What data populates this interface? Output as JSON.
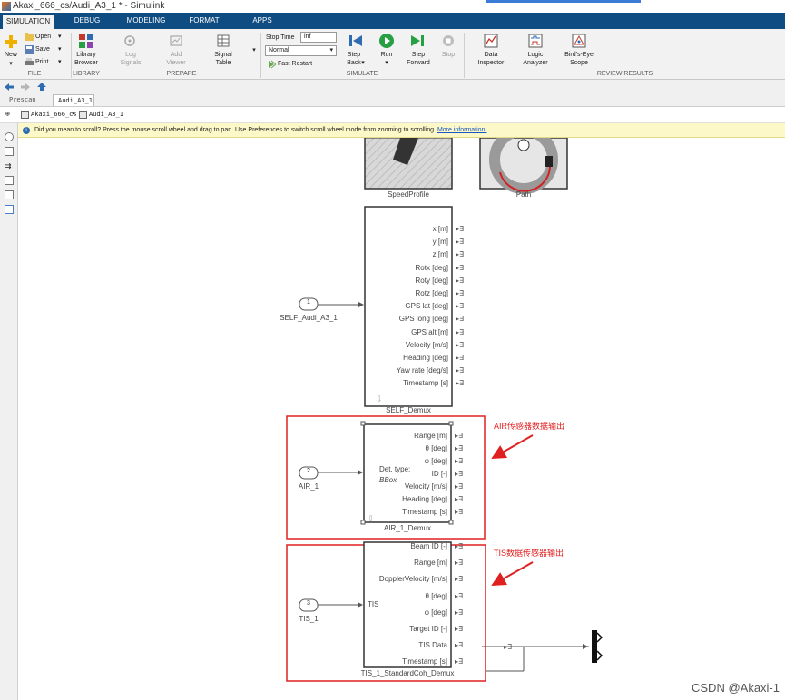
{
  "window": {
    "title": "Akaxi_666_cs/Audi_A3_1 * - Simulink"
  },
  "tabs": [
    "SIMULATION",
    "DEBUG",
    "MODELING",
    "FORMAT",
    "APPS"
  ],
  "ribbon": {
    "file": {
      "new_label": "New",
      "open_label": "Open",
      "save_label": "Save",
      "print_label": "Print",
      "group_label": "FILE"
    },
    "library": {
      "browser_label_1": "Library",
      "browser_label_2": "Browser",
      "group_label": "LIBRARY"
    },
    "prepare": {
      "log_signals_1": "Log",
      "log_signals_2": "Signals",
      "add_viewer_1": "Add",
      "add_viewer_2": "Viewer",
      "signal_table_1": "Signal",
      "signal_table_2": "Table",
      "group_label": "PREPARE"
    },
    "simulate": {
      "stop_time_label": "Stop Time",
      "stop_time_value": "inf",
      "mode_value": "Normal",
      "fast_restart_label": "Fast Restart",
      "step_back_1": "Step",
      "step_back_2": "Back",
      "run_label": "Run",
      "step_forward_1": "Step",
      "step_forward_2": "Forward",
      "stop_label": "Stop",
      "group_label": "SIMULATE"
    },
    "review": {
      "data_inspector_1": "Data",
      "data_inspector_2": "Inspector",
      "logic_analyzer_1": "Logic",
      "logic_analyzer_2": "Analyzer",
      "birds_eye_1": "Bird's-Eye",
      "birds_eye_2": "Scope",
      "group_label": "REVIEW RESULTS"
    }
  },
  "nav": {
    "prescan_label": "Prescan",
    "doc_tab": "Audi_A3_1",
    "crumb_root": "Akaxi_666_cs",
    "crumb_child": "Audi_A3_1"
  },
  "info": {
    "message": "Did you mean to scroll? Press the mouse scroll wheel and drag to pan. Use Preferences to switch scroll wheel mode from zooming to scrolling.",
    "link": "More information."
  },
  "model": {
    "speed_profile_label": "SpeedProfile",
    "path_label": "Path",
    "self_demux": {
      "label": "SELF_Demux",
      "inport_number": "1",
      "inport_label": "SELF_Audi_A3_1",
      "ports": [
        "x [m]",
        "y [m]",
        "z [m]",
        "Rotx [deg]",
        "Roty [deg]",
        "Rotz [deg]",
        "GPS lat [deg]",
        "GPS long [deg]",
        "GPS alt [m]",
        "Velocity [m/s]",
        "Heading [deg]",
        "Yaw rate [deg/s]",
        "Timestamp [s]"
      ]
    },
    "air_demux": {
      "label": "AIR_1_Demux",
      "inport_number": "2",
      "inport_label": "AIR_1",
      "det_type_line1": "Det. type:",
      "det_type_line2": "BBox",
      "ports": [
        "Range [m]",
        "θ [deg]",
        "φ [deg]",
        "ID [-]",
        "Velocity [m/s]",
        "Heading [deg]",
        "Timestamp [s]"
      ],
      "annotation": "AIR传感器数据输出"
    },
    "tis_demux": {
      "label": "TIS_1_StandardCoh_Demux",
      "inport_number": "3",
      "inport_label": "TIS_1",
      "in_label": "TIS",
      "ports": [
        "Beam ID [-]",
        "Range [m]",
        "DopplerVelocity [m/s]",
        "θ [deg]",
        "φ [deg]",
        "Target ID [-]",
        "TIS Data",
        "Timestamp [s]"
      ],
      "annotation": "TIS数据传感器输出"
    }
  },
  "watermark": "CSDN @Akaxi-1",
  "colors": {
    "tabbar": "#0f4c81",
    "annotation_red": "#e02020",
    "info_bg": "#fdf8c8",
    "link": "#1a56c4"
  }
}
